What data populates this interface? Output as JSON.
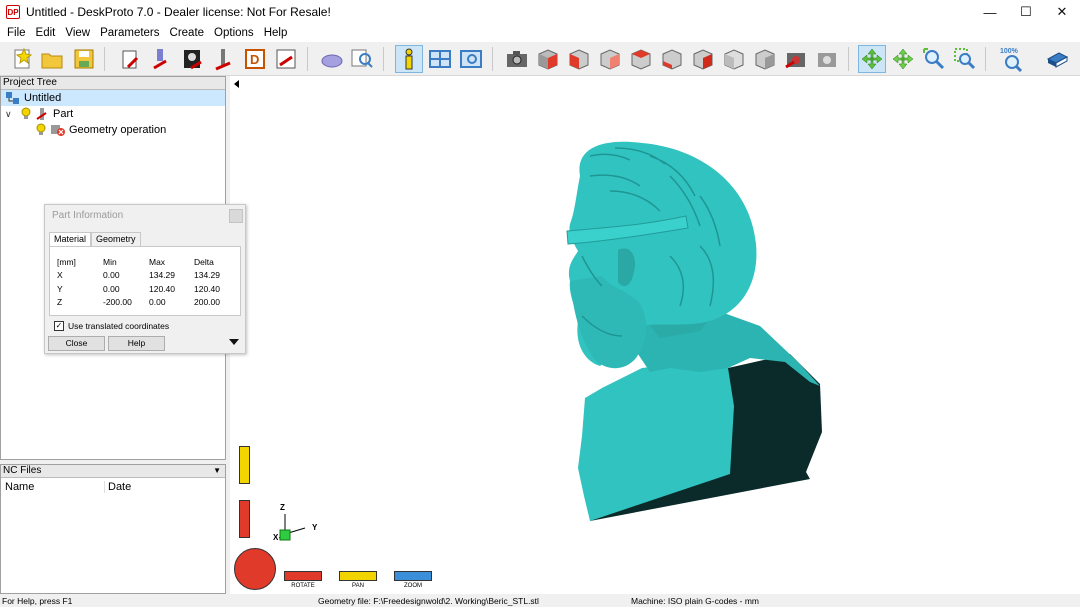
{
  "window": {
    "title": "Untitled - DeskProto 7.0 - Dealer license: Not For Resale!",
    "app_icon_text": "DP",
    "minimize_glyph": "—",
    "maximize_glyph": "☐",
    "close_glyph": "✕"
  },
  "menu": [
    "File",
    "Edit",
    "View",
    "Parameters",
    "Create",
    "Options",
    "Help"
  ],
  "toolbar": {
    "zoom_label": "100%",
    "icons": [
      "new-project-icon",
      "open-project-icon",
      "save-project-icon",
      "new-geometry-op-icon",
      "add-part-icon",
      "bitmap-icon",
      "vector-icon",
      "edit-d-icon",
      "save-part-icon",
      "3d-view-icon",
      "zoom-find-icon",
      "info-icon",
      "layout-icon",
      "screen-icon",
      "camera-icon",
      "view-iso-icon",
      "view-front-icon",
      "view-back-icon",
      "view-left-icon",
      "view-right-icon",
      "view-top-icon",
      "view-bottom-icon",
      "view-gray1-icon",
      "view-gray2-icon",
      "render-icon",
      "render-gray-icon",
      "rotate-mode-icon",
      "pan-mode-icon",
      "zoom-in-icon",
      "zoom-box-icon",
      "zoom-100-icon",
      "help-book-icon"
    ]
  },
  "project_tree": {
    "header": "Project Tree",
    "items": [
      {
        "label": "Untitled"
      },
      {
        "label": "Part"
      },
      {
        "label": "Geometry operation"
      }
    ]
  },
  "nc_files": {
    "header": "NC Files",
    "columns": [
      "Name",
      "Date"
    ]
  },
  "part_info": {
    "title": "Part Information",
    "tabs": [
      "Material",
      "Geometry"
    ],
    "header_row": [
      "[mm]",
      "Min",
      "Max",
      "Delta"
    ],
    "rows": [
      [
        "X",
        "0.00",
        "134.29",
        "134.29"
      ],
      [
        "Y",
        "0.00",
        "120.40",
        "120.40"
      ],
      [
        "Z",
        "-200.00",
        "0.00",
        "200.00"
      ]
    ],
    "checkbox_label": "Use translated coordinates",
    "checkbox_checked": true,
    "close_label": "Close",
    "help_label": "Help"
  },
  "view_modes": {
    "rotate_label": "ROTATE",
    "pan_label": "PAN",
    "zoom_label": "ZOOM"
  },
  "axes": {
    "x": "X",
    "y": "Y",
    "z": "Z"
  },
  "model": {
    "color": "#31c3c0",
    "shadow_color": "#0b2a2a"
  },
  "statusbar": {
    "help": "For Help, press F1",
    "geometry_file": "Geometry file: F:\\Freedesignwold\\2. Working\\Beric_STL.stl",
    "machine": "Machine: ISO plain G-codes - mm"
  }
}
